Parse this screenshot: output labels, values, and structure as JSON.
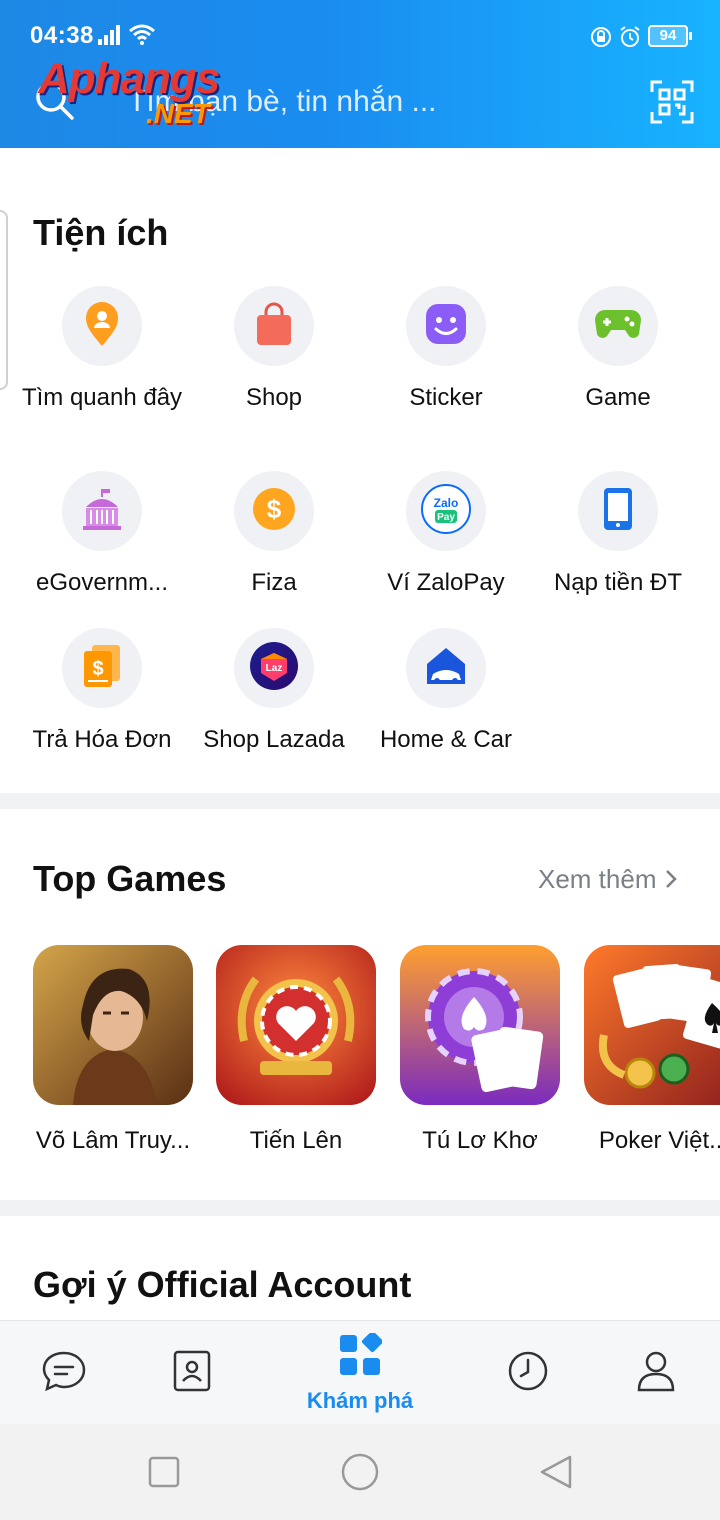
{
  "status_bar": {
    "time": "04:38",
    "battery": "94"
  },
  "header": {
    "search_placeholder": "Tìm bạn bè, tin nhắn ...",
    "watermark_line1": "Aphangs",
    "watermark_line2": ".NET"
  },
  "utilities": {
    "title": "Tiện ích",
    "items": [
      {
        "label": "Tìm quanh đây",
        "icon": "location-pin-icon"
      },
      {
        "label": "Shop",
        "icon": "shopping-bag-icon"
      },
      {
        "label": "Sticker",
        "icon": "sticker-face-icon"
      },
      {
        "label": "Game",
        "icon": "gamepad-icon"
      },
      {
        "label": "eGovernm...",
        "icon": "government-building-icon"
      },
      {
        "label": "Fiza",
        "icon": "dollar-coin-icon"
      },
      {
        "label": "Ví ZaloPay",
        "icon": "zalopay-icon"
      },
      {
        "label": "Nạp tiền ĐT",
        "icon": "phone-icon"
      },
      {
        "label": "Trả Hóa Đơn",
        "icon": "bill-icon"
      },
      {
        "label": "Shop Lazada",
        "icon": "lazada-icon"
      },
      {
        "label": "Home & Car",
        "icon": "home-car-icon"
      }
    ],
    "zalopay_text1": "Zalo",
    "zalopay_text2": "Pay",
    "lazada_text": "Laz"
  },
  "top_games": {
    "title": "Top Games",
    "more_label": "Xem thêm",
    "items": [
      {
        "label": "Võ Lâm Truy..."
      },
      {
        "label": "Tiến Lên"
      },
      {
        "label": "Tú Lơ Khơ"
      },
      {
        "label": "Poker Việt..."
      }
    ]
  },
  "official_account": {
    "title": "Gợi ý Official Account"
  },
  "bottom_nav": {
    "active_label": "Khám phá"
  },
  "colors": {
    "accent": "#1a8cf0",
    "header_start": "#1e88e5",
    "header_end": "#18b3ff"
  }
}
